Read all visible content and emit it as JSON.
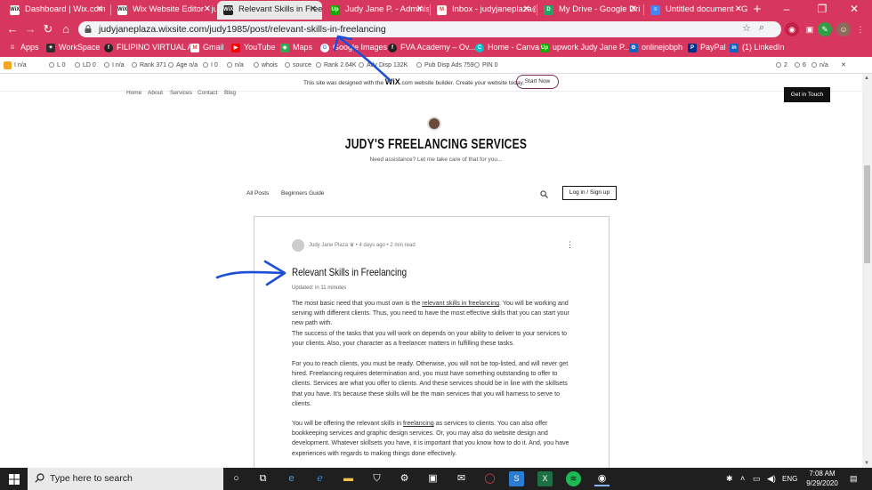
{
  "browser": {
    "tabs": [
      {
        "title": "Dashboard | Wix.com",
        "favicon": "WiX",
        "color": "#222222"
      },
      {
        "title": "Wix Website Editor - ju",
        "favicon": "WiX",
        "color": "#222222"
      },
      {
        "title": "Relevant Skills in Freel",
        "favicon": "WiX",
        "color": "#222222",
        "active": true
      },
      {
        "title": "Judy Jane P. - Administ",
        "favicon": "Up",
        "color": "#14a800"
      },
      {
        "title": "Inbox - judyjaneplaza@",
        "favicon": "M",
        "color": "#ea4335"
      },
      {
        "title": "My Drive - Google Dri",
        "favicon": "D",
        "color": "#1fa463"
      },
      {
        "title": "Untitled document - G",
        "favicon": "≡",
        "color": "#4285f4"
      }
    ],
    "url": "judyjaneplaza.wixsite.com/judy1985/post/relevant-skills-in-freelancing",
    "bookmarks": [
      {
        "label": "Apps",
        "color": "#4285f4"
      },
      {
        "label": "WorkSpace",
        "color": "#2f2f2f"
      },
      {
        "label": "FILIPINO VIRTUAL A...",
        "color": "#222222"
      },
      {
        "label": "Gmail",
        "color": "#ea4335"
      },
      {
        "label": "YouTube",
        "color": "#ff0000"
      },
      {
        "label": "Maps",
        "color": "#34a853"
      },
      {
        "label": "Google Images",
        "color": "#4285f4"
      },
      {
        "label": "FVA Academy – Ov...",
        "color": "#222222"
      },
      {
        "label": "Home - Canva",
        "color": "#00c4cc"
      },
      {
        "label": "upwork Judy Jane P...",
        "color": "#14a800"
      },
      {
        "label": "onlinejobph",
        "color": "#1565c0"
      },
      {
        "label": "PayPal",
        "color": "#003087"
      },
      {
        "label": "(1) LinkedIn",
        "color": "#0a66c2"
      }
    ],
    "seo_bar": [
      "I n/a",
      "L 0",
      "LD 0",
      "I n/a",
      "Rank 371",
      "Age n/a",
      "I 0",
      "n/a",
      "whois",
      "source",
      "Rank 2.64K",
      "Adv Disp 132K",
      "Pub Disp Ads 759",
      "PIN 0"
    ],
    "seo_right": [
      "2",
      "6",
      "n/a"
    ]
  },
  "wix_banner": {
    "text": "This site was designed with the",
    "brand": "WiX",
    "text2": ".com website builder. Create your website today.",
    "button": "Start Now"
  },
  "site": {
    "nav": [
      "Home",
      "About",
      "Services",
      "Contact",
      "Blog"
    ],
    "cta": "Get in Touch",
    "title": "JUDY'S FREELANCING SERVICES",
    "tagline": "Need assistance? Let me take care of that for you...",
    "blog_nav": [
      "All Posts",
      "Beginners Guide"
    ],
    "login": "Log in / Sign up"
  },
  "post": {
    "author": "Judy Jane Plaza",
    "meta": "• 4 days ago • 2 min read",
    "title": "Relevant Skills in Freelancing",
    "updated": "Updated: in 11 minutes",
    "p1a": "The most basic need that you must own is the ",
    "p1link": "relevant skills in freelancing",
    "p1b": ". You will be working and serving with different clients. Thus, you need to have the most effective skills that you can start your new path with.",
    "p2": "The success of the tasks that you will work on depends on your ability to deliver to your services to your clients. Also, your character as a freelancer matters in fulfilling these tasks.",
    "p3": "For you to reach clients, you must be ready. Otherwise, you will not be top-listed, and will never get hired. Freelancing requires determination and, you must have something outstanding to offer to clients. Services are what you offer to clients. And these services should be in line with the skillsets that you have. It's because these skills will be the main services that you will harness to serve to clients.",
    "p4a": "You will be offering the relevant skills in ",
    "p4link": "freelancing",
    "p4b": " as services to clients. You can also offer bookkeeping services and graphic design services. Or, you may also do website design and development. Whatever skillsets you have, it is important that you know how to do it. And, you have experiences with regards to making things done effectively."
  },
  "taskbar": {
    "search_placeholder": "Type here to search",
    "lang": "ENG",
    "time": "7:08 AM",
    "date": "9/29/2020"
  },
  "colors": {
    "chrome": "#d7375f",
    "arrow": "#1a4fd6",
    "taskbar": "#1f1f1f"
  }
}
